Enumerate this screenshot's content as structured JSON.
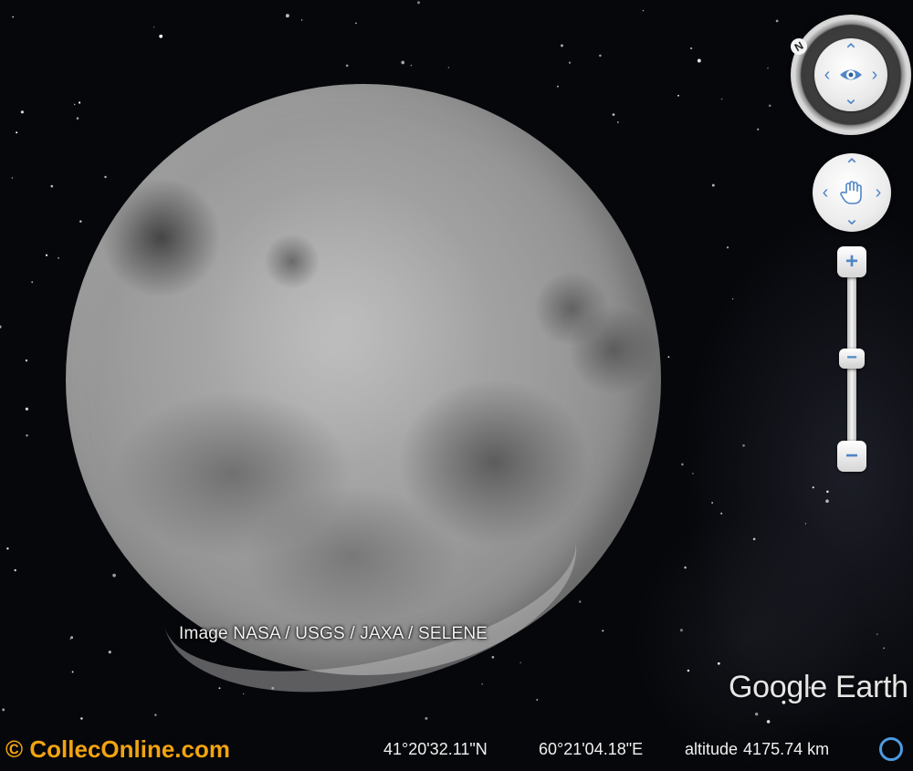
{
  "viewer": {
    "attribution": "Image NASA / USGS / JAXA / SELENE",
    "logo": "Google Earth"
  },
  "watermark": "© CollecOnline.com",
  "status_bar": {
    "latitude": "41°20'32.11\"N",
    "longitude": "60°21'04.18\"E",
    "altitude_label": "altitude",
    "altitude_value": "4175.74 km"
  },
  "controls": {
    "north_label": "N",
    "arrows": {
      "up": "⌃",
      "down": "⌄",
      "left": "‹",
      "right": "›"
    },
    "zoom_in_label": "+",
    "zoom_out_label": "−",
    "zoom_slider_label": "−",
    "icons": [
      "eye-icon",
      "hand-icon",
      "status-ring-icon"
    ]
  },
  "colors": {
    "accent_blue": "#4f86c6",
    "watermark_orange": "#f2a40f",
    "status_ring": "#4d9be0"
  }
}
